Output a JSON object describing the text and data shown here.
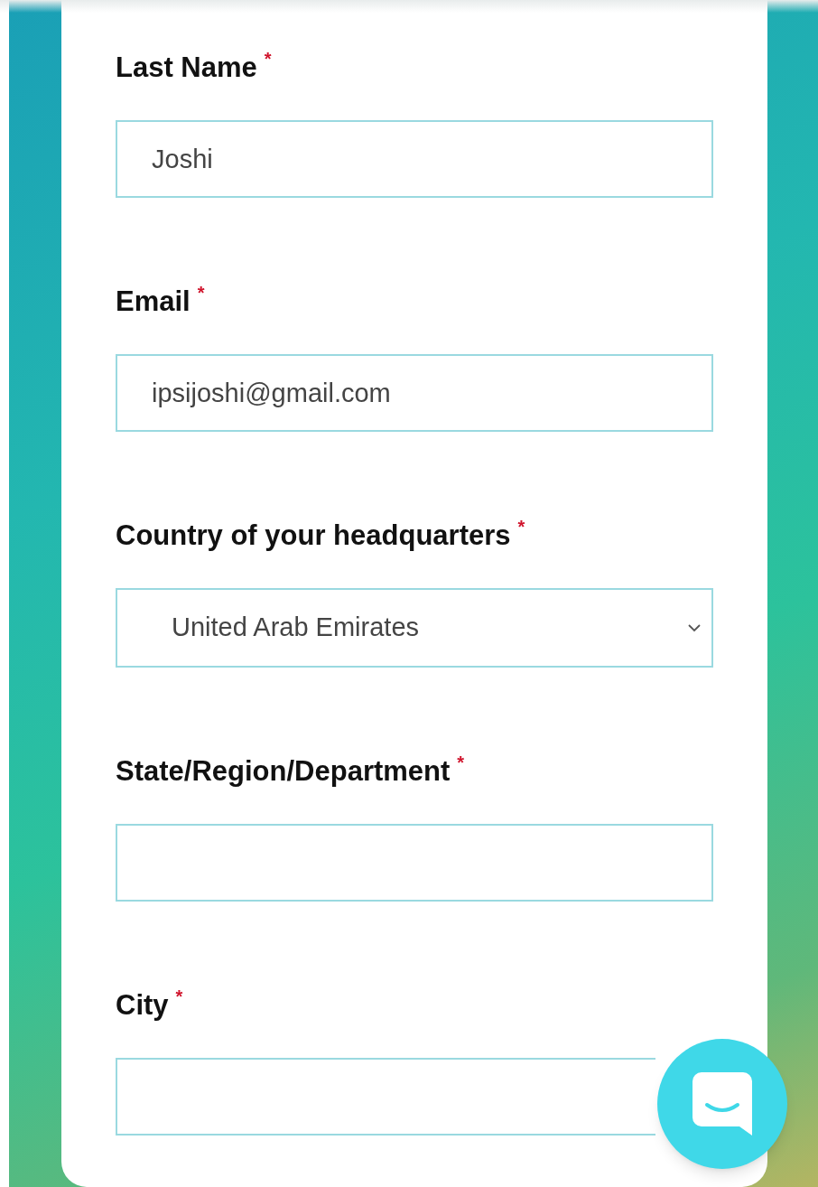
{
  "form": {
    "fields": [
      {
        "kind": "text",
        "label": "Last Name",
        "required_mark": "*",
        "value": "Joshi"
      },
      {
        "kind": "text",
        "label": "Email",
        "required_mark": "*",
        "value": "ipsijoshi@gmail.com"
      },
      {
        "kind": "select",
        "label": "Country of your headquarters",
        "required_mark": "*",
        "value": "United Arab Emirates"
      },
      {
        "kind": "text",
        "label": "State/Region/Department",
        "required_mark": "*"
      },
      {
        "kind": "text",
        "label": "City",
        "required_mark": "*"
      }
    ]
  }
}
